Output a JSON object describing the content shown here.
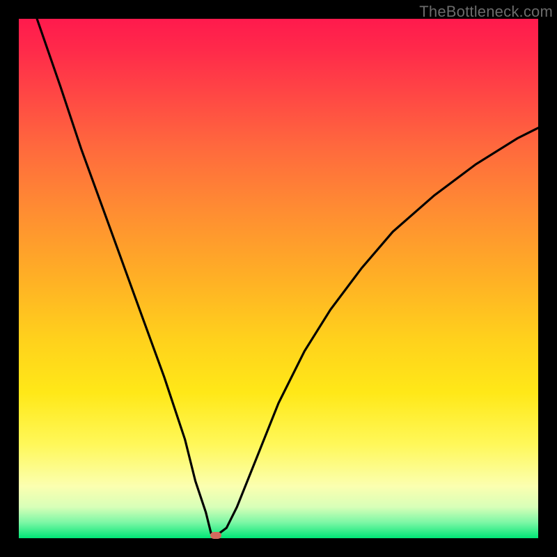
{
  "watermark": {
    "text": "TheBottleneck.com"
  },
  "colors": {
    "frame": "#000000",
    "gradient_top": "#ff1a4d",
    "gradient_bottom": "#00e676",
    "curve": "#000000",
    "min_marker": "#d46a5e",
    "watermark": "#6b6b6b"
  },
  "chart_data": {
    "type": "line",
    "title": "",
    "xlabel": "",
    "ylabel": "",
    "xlim": [
      0,
      100
    ],
    "ylim": [
      0,
      100
    ],
    "grid": false,
    "legend": false,
    "series": [
      {
        "name": "bottleneck-curve",
        "x": [
          3.5,
          8,
          12,
          16,
          20,
          24,
          28,
          32,
          34,
          36,
          37,
          38,
          40,
          42,
          46,
          50,
          55,
          60,
          66,
          72,
          80,
          88,
          96,
          100
        ],
        "values": [
          100,
          87,
          75,
          64,
          53,
          42,
          31,
          19,
          11,
          5,
          1,
          0.5,
          2,
          6,
          16,
          26,
          36,
          44,
          52,
          59,
          66,
          72,
          77,
          79
        ]
      }
    ],
    "annotations": [
      {
        "type": "marker",
        "name": "min-point",
        "x": 38,
        "y": 0.5,
        "shape": "pill",
        "color": "#d46a5e"
      }
    ],
    "background": {
      "type": "vertical-gradient",
      "stops": [
        {
          "pos": 0,
          "color": "#ff1a4d"
        },
        {
          "pos": 50,
          "color": "#ffb025"
        },
        {
          "pos": 82,
          "color": "#fff85a"
        },
        {
          "pos": 100,
          "color": "#00e676"
        }
      ]
    }
  }
}
